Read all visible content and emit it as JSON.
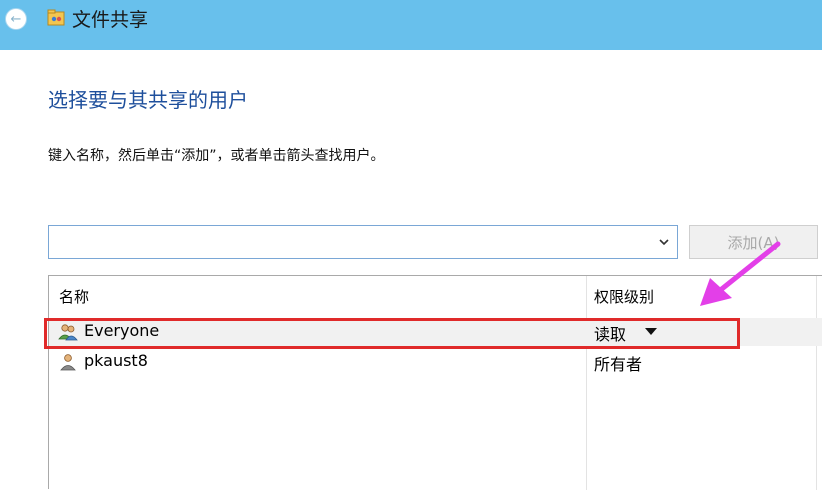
{
  "window": {
    "title": "文件共享",
    "back_icon": "back-arrow-icon",
    "app_icon": "file-sharing-icon"
  },
  "main": {
    "heading": "选择要与其共享的用户",
    "instruction": "键入名称，然后单击“添加”，或者单击箭头查找用户。",
    "user_input": {
      "value": "",
      "placeholder": ""
    },
    "add_button_label": "添加(A)",
    "add_button_enabled": false
  },
  "list": {
    "columns": {
      "name": "名称",
      "permission": "权限级别"
    },
    "rows": [
      {
        "name": "Everyone",
        "permission": "读取",
        "icon": "user-group-icon",
        "has_dropdown": true,
        "selected": true
      },
      {
        "name": "pkaust8",
        "permission": "所有者",
        "icon": "user-icon",
        "has_dropdown": false,
        "selected": false
      }
    ]
  },
  "annotations": {
    "highlight_color": "#e02a2a",
    "arrow_color": "#e33fe8"
  },
  "colors": {
    "titlebar": "#68c0ec",
    "heading": "#1e4f9c"
  }
}
